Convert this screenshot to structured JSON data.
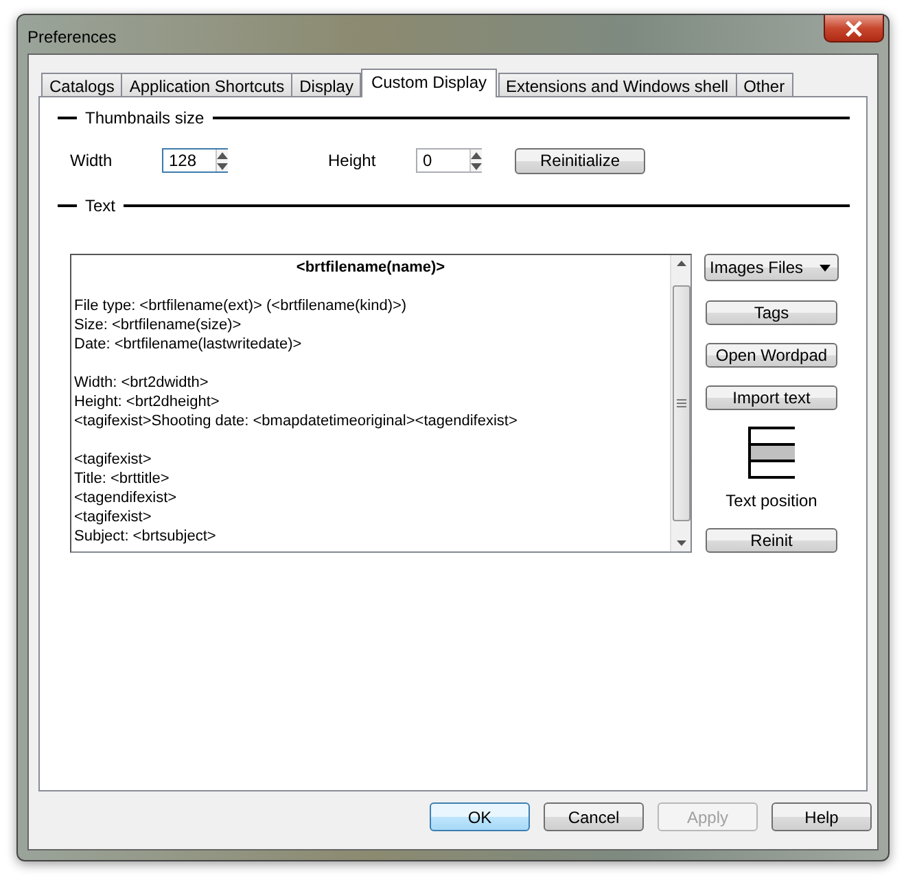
{
  "window": {
    "title": "Preferences"
  },
  "tabs": [
    {
      "label": "Catalogs",
      "selected": false
    },
    {
      "label": "Application Shortcuts",
      "selected": false
    },
    {
      "label": "Display",
      "selected": false
    },
    {
      "label": "Custom Display",
      "selected": true
    },
    {
      "label": "Extensions and Windows shell",
      "selected": false
    },
    {
      "label": "Other",
      "selected": false
    }
  ],
  "thumbnails_size": {
    "title": "Thumbnails size",
    "width_label": "Width",
    "width_value": "128",
    "height_label": "Height",
    "height_value": "0",
    "reinitialize_button": "Reinitialize"
  },
  "text_section": {
    "title": "Text",
    "editor_heading": "<brtfilename(name)>",
    "editor_paragraphs": [
      [
        "File type: <brtfilename(ext)> (<brtfilename(kind)>)",
        "Size: <brtfilename(size)>",
        "Date: <brtfilename(lastwritedate)>"
      ],
      [
        "Width: <brt2dwidth>",
        "Height: <brt2dheight>",
        "<tagifexist>Shooting date: <bmapdatetimeoriginal><tagendifexist>"
      ],
      [
        "<tagifexist>",
        "Title: <brttitle>",
        "<tagendifexist>",
        "<tagifexist>",
        "Subject: <brtsubject>"
      ]
    ],
    "file_type_dropdown": "Images Files",
    "buttons": [
      {
        "label": "Tags",
        "disabled": false
      },
      {
        "label": "Open Wordpad",
        "disabled": false
      },
      {
        "label": "Import text",
        "disabled": false
      }
    ],
    "text_position": {
      "label": "Text position",
      "slots": [
        {
          "selected": false
        },
        {
          "selected": true
        },
        {
          "selected": false
        }
      ]
    },
    "reinit_button": "Reinit"
  },
  "dialog_buttons": [
    {
      "label": "OK",
      "default": true,
      "disabled": false
    },
    {
      "label": "Cancel",
      "default": false,
      "disabled": false
    },
    {
      "label": "Apply",
      "default": false,
      "disabled": true
    },
    {
      "label": "Help",
      "default": false,
      "disabled": false
    }
  ]
}
